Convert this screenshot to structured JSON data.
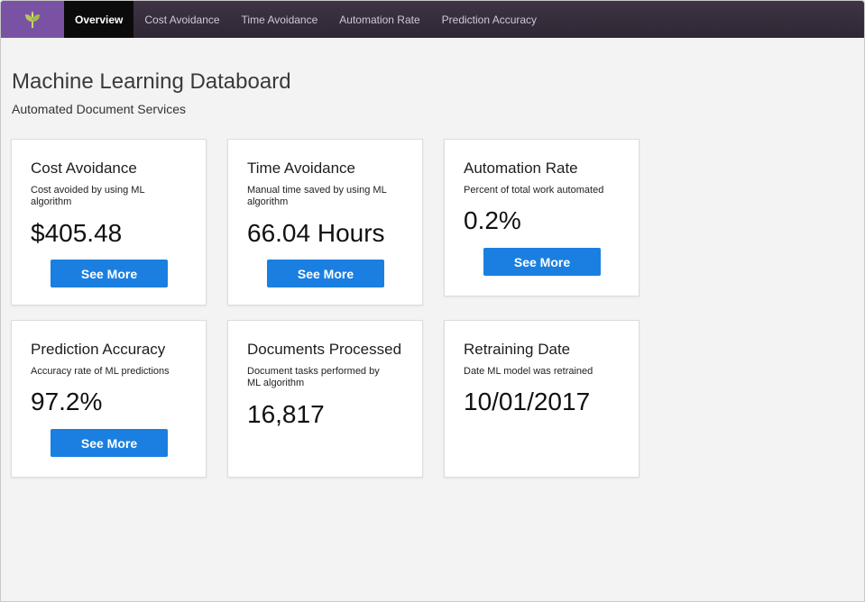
{
  "nav": {
    "tabs": [
      {
        "label": "Overview",
        "active": true
      },
      {
        "label": "Cost Avoidance",
        "active": false
      },
      {
        "label": "Time Avoidance",
        "active": false
      },
      {
        "label": "Automation Rate",
        "active": false
      },
      {
        "label": "Prediction Accuracy",
        "active": false
      }
    ],
    "logo_icon": "leaf-sprout-icon"
  },
  "header": {
    "title": "Machine Learning Databoard",
    "subtitle": "Automated Document Services"
  },
  "cards": [
    {
      "title": "Cost Avoidance",
      "description": "Cost avoided by using ML algorithm",
      "value": "$405.48",
      "button": "See More"
    },
    {
      "title": "Time Avoidance",
      "description": "Manual time saved by using ML algorithm",
      "value": "66.04 Hours",
      "button": "See More"
    },
    {
      "title": "Automation Rate",
      "description": "Percent of total work automated",
      "value": "0.2%",
      "button": "See More"
    },
    {
      "title": "Prediction Accuracy",
      "description": "Accuracy rate of ML predictions",
      "value": "97.2%",
      "button": "See More"
    },
    {
      "title": "Documents Processed",
      "description": "Document tasks performed by ML algorithm",
      "value": "16,817"
    },
    {
      "title": "Retraining Date",
      "description": "Date ML model was retrained",
      "value": "10/01/2017"
    }
  ],
  "colors": {
    "accent": "#1a7fe0",
    "nav_background": "#352c39",
    "logo_background": "#7a52a3"
  }
}
